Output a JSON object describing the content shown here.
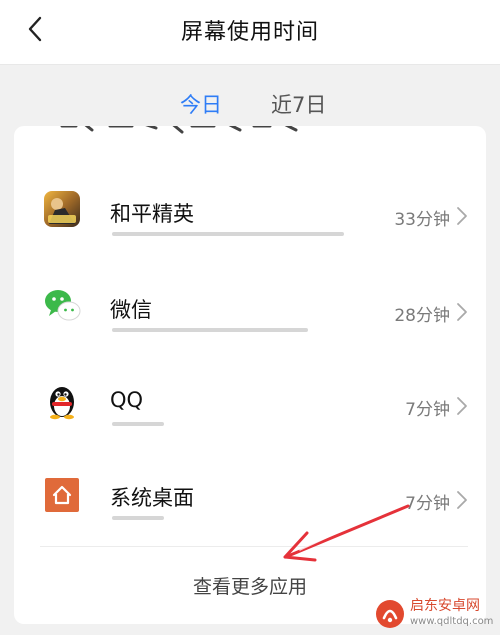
{
  "header": {
    "title": "屏幕使用时间"
  },
  "tabs": [
    {
      "label": "今日",
      "active": true
    },
    {
      "label": "近7日",
      "active": false
    }
  ],
  "card": {
    "apps": [
      {
        "name": "和平精英",
        "time": "33分钟"
      },
      {
        "name": "微信",
        "time": "28分钟"
      },
      {
        "name": "QQ",
        "time": "7分钟"
      },
      {
        "name": "系统桌面",
        "time": "7分钟"
      }
    ],
    "more_label": "查看更多应用"
  },
  "watermark": {
    "name": "启东安卓网",
    "url": "www.qdltdq.com"
  },
  "colors": {
    "accent": "#2f7df6",
    "annotation_arrow": "#e5323a"
  }
}
